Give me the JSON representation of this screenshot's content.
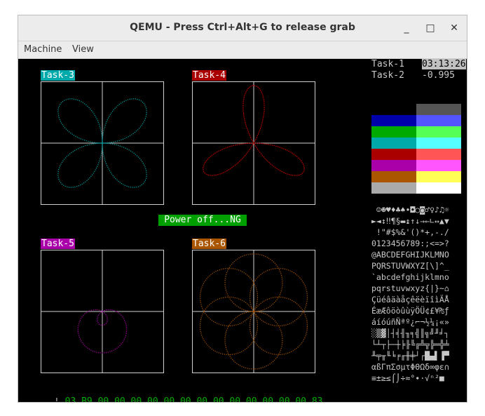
{
  "window": {
    "title": "QEMU - Press Ctrl+Alt+G to release grab",
    "minimize_glyph": "_",
    "maximize_glyph": "□",
    "close_glyph": "✕"
  },
  "menubar": {
    "items": [
      "Machine",
      "View"
    ]
  },
  "tasks": [
    {
      "label": "Task-3",
      "color": "#00aaaa",
      "curve": "rose",
      "k": 2,
      "amplitude": 1.0
    },
    {
      "label": "Task-4",
      "color": "#aa0000",
      "curve": "rose",
      "k": 3,
      "amplitude": 1.0
    },
    {
      "label": "Task-5",
      "color": "#aa00aa",
      "curve": "limacon",
      "a": 0.5,
      "b": 1.0
    },
    {
      "label": "Task-6",
      "color": "#aa5500",
      "curve": "petal-circles",
      "count": 6
    }
  ],
  "status_banner": "Power off...NG",
  "right_panel": {
    "row1_label": "Task-1",
    "row1_value": "03:13:26",
    "row2_label": "Task-2",
    "row2_value": "-0.995"
  },
  "palette": [
    "#000000",
    "#555555",
    "#0000aa",
    "#5555ff",
    "#00aa00",
    "#55ff55",
    "#00aaaa",
    "#55ffff",
    "#aa0000",
    "#ff5555",
    "#aa00aa",
    "#ff55ff",
    "#aa5500",
    "#ffff55",
    "#aaaaaa",
    "#ffffff"
  ],
  "charset_lines": [
    " ☺☻♥♦♣♠•◘○◙♂♀♪♫☼",
    "►◄↕‼¶§▬↨↑↓→←∟↔▲▼",
    " !\"#$%&'()*+,-./",
    "0123456789:;<=>?",
    "@ABCDEFGHIJKLMNO",
    "PQRSTUVWXYZ[\\]^_",
    "`abcdefghijklmno",
    "pqrstuvwxyz{|}~⌂",
    "ÇüéâäàåçêëèïîìÄÅ",
    "ÉæÆôöòûùÿÖÜ¢£¥₧ƒ",
    "áíóúñÑªº¿⌐¬½¼¡«»",
    "░▒▓│┤╡╢╖╕╣║╗╝╜╛┐",
    "└┴┬├─┼╞╟╚╔╩╦╠═╬╧",
    "╨╤╥╙╘╒╓╫╪┘┌█▄▌▐▀",
    "αßΓπΣσµτΦΘΩδ∞φε∩",
    "≡±≥≤⌠⌡÷≈°∙·√ⁿ²■ "
  ],
  "hex_line": "03 B9 00 00 00 00 00 00 00 00 00 00 00 00 00 83"
}
